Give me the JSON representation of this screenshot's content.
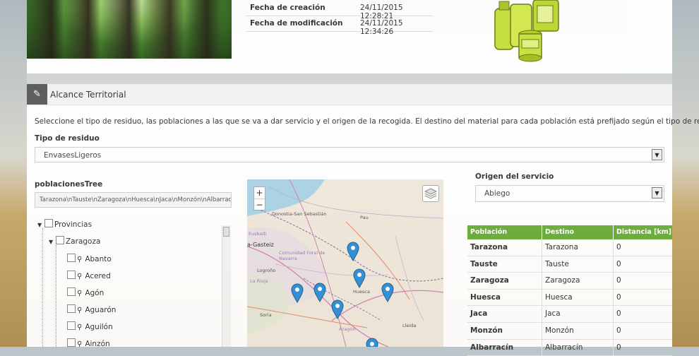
{
  "meta": {
    "created_label": "Fecha de creación",
    "created_value": "24/11/2015 12:28:21",
    "modified_label": "Fecha de modificación",
    "modified_value": "24/11/2015 12:34:26"
  },
  "section": {
    "icon": "edit-icon",
    "title": "Alcance Territorial",
    "description": "Seleccione el tipo de residuo, las poblaciones a las que se va a dar servicio y el origen de la recogida. El destino del material para cada población está prefijado según el tipo de residuo"
  },
  "residuo": {
    "label": "Tipo de residuo",
    "value": "EnvasesLigeros"
  },
  "poblaciones": {
    "label": "poblacionesTree",
    "value": "Tarazona\\nTauste\\nZaragoza\\nHuesca\\nJaca\\nMonzón\\nAlbarracín"
  },
  "tree": {
    "root": "Provincias",
    "province": "Zaragoza",
    "items": [
      "Abanto",
      "Acered",
      "Agón",
      "Aguarón",
      "Aguilón",
      "Ainzón"
    ]
  },
  "origen": {
    "label": "Origen del servicio",
    "value": "Abiego"
  },
  "map": {
    "zoom_in": "+",
    "zoom_out": "−",
    "labels": [
      "Donostia-San Sebastián",
      "Pau",
      "a-Gasteiz",
      "Euskadi",
      "Comunidad Foral de Navarra",
      "Logroño",
      "La Rioja",
      "Huesca",
      "Aragón",
      "Soria",
      "Lleida"
    ]
  },
  "table": {
    "headers": [
      "Población",
      "Destino",
      "Distancia [km]"
    ],
    "rows": [
      [
        "Tarazona",
        "Tarazona",
        "0"
      ],
      [
        "Tauste",
        "Tauste",
        "0"
      ],
      [
        "Zaragoza",
        "Zaragoza",
        "0"
      ],
      [
        "Huesca",
        "Huesca",
        "0"
      ],
      [
        "Jaca",
        "Jaca",
        "0"
      ],
      [
        "Monzón",
        "Monzón",
        "0"
      ],
      [
        "Albarracín",
        "Albarracín",
        "0"
      ]
    ]
  },
  "colors": {
    "table_header": "#6aad3c",
    "section_icon_bg": "#5a5a5a",
    "marker": "#2f8fd8"
  }
}
